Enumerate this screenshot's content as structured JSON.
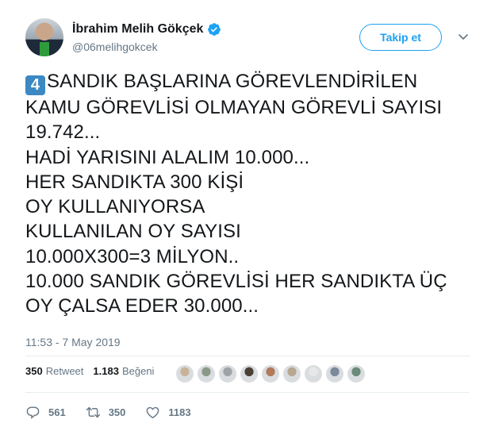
{
  "user": {
    "name": "İbrahim Melih Gökçek",
    "handle": "@06melihgokcek"
  },
  "follow_label": "Takip et",
  "tweet": {
    "emoji": "4",
    "text": "SANDIK BAŞLARINA GÖREVLENDİRİLEN KAMU GÖREVLİSİ OLMAYAN GÖREVLİ SAYISI 19.742...\nHADİ YARISINI ALALIM 10.000...\nHER SANDIKTA 300 KİŞİ\nOY KULLANIYORSA\nKULLANILAN OY SAYISI\n10.000X300=3 MİLYON..\n10.000 SANDIK GÖREVLİSİ HER SANDIKTA ÜÇ OY ÇALSA EDER 30.000..."
  },
  "timestamp": "11:53 - 7 May 2019",
  "stats": {
    "retweets_count": "350",
    "retweets_label": "Retweet",
    "likes_count": "1.183",
    "likes_label": "Beğeni"
  },
  "likers": [
    {
      "color": "#c8b39a"
    },
    {
      "color": "#8a9a88"
    },
    {
      "color": "#9ea3a8"
    },
    {
      "color": "#4a4036"
    },
    {
      "color": "#b37a5a"
    },
    {
      "color": "#b8a890"
    },
    {
      "color": "#e8e8e8"
    },
    {
      "color": "#7a8a9a"
    },
    {
      "color": "#6a8a7a"
    }
  ],
  "actions": {
    "reply_count": "561",
    "retweet_count": "350",
    "like_count": "1183"
  },
  "colors": {
    "accent": "#1da1f2",
    "text": "#14171a",
    "muted": "#657786",
    "keycap": "#3b88c3"
  }
}
